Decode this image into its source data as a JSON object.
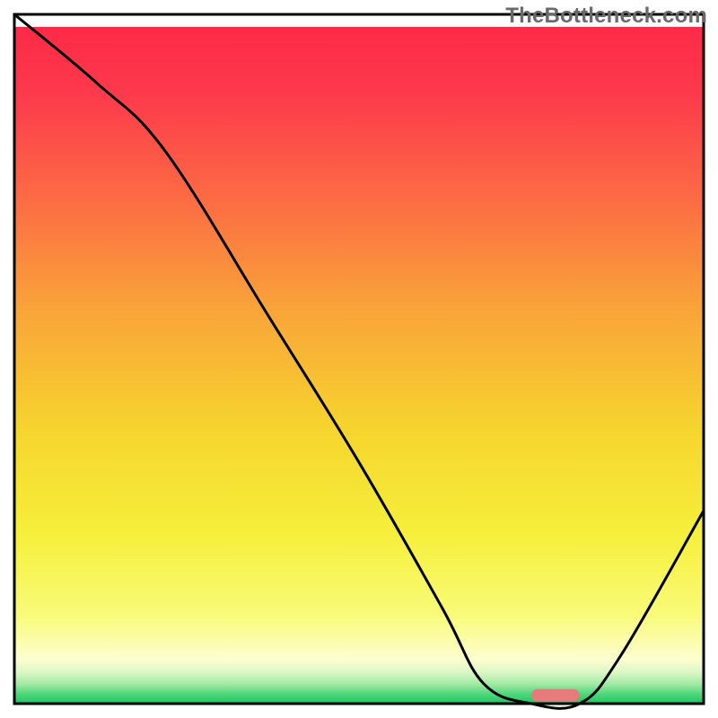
{
  "watermark": "TheBottleneck.com",
  "chart_data": {
    "type": "line",
    "title": "",
    "xlabel": "",
    "ylabel": "",
    "xlim": [
      0,
      100
    ],
    "ylim": [
      0,
      100
    ],
    "grid": false,
    "series": [
      {
        "name": "curve",
        "x": [
          0,
          12,
          22,
          37,
          50,
          62,
          68,
          75,
          82,
          88,
          100
        ],
        "y": [
          100,
          90,
          80,
          56,
          35,
          14,
          3,
          0,
          0,
          7,
          28
        ]
      }
    ],
    "marker": {
      "x_start": 75,
      "x_end": 82,
      "y": 1.2,
      "color": "#e77b7b"
    }
  }
}
